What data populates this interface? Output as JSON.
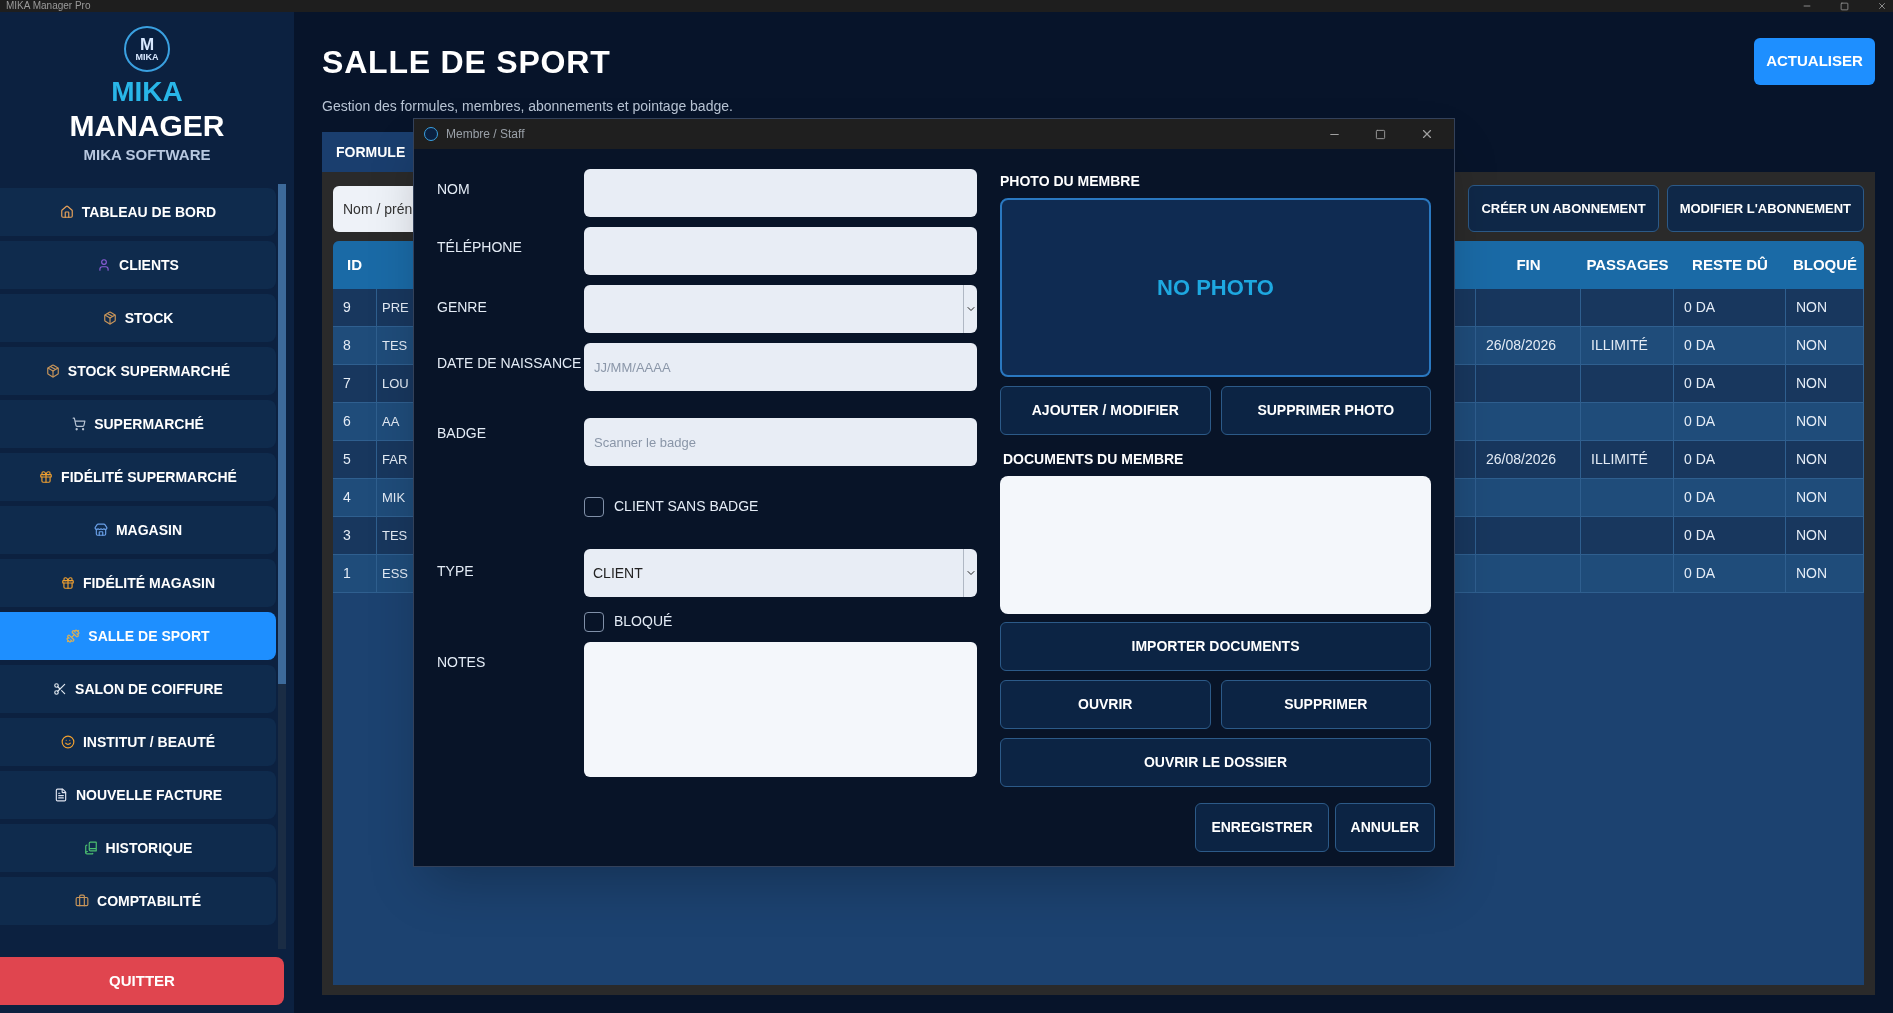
{
  "window": {
    "title": "MIKA Manager Pro"
  },
  "sidebar": {
    "logo": {
      "mark": "M",
      "text": "MIKA"
    },
    "brand_top": "MIKA",
    "brand_bottom": "MANAGER",
    "subtitle": "MIKA SOFTWARE",
    "items": [
      {
        "label": "TABLEAU DE BORD",
        "selected": false
      },
      {
        "label": "CLIENTS",
        "selected": false
      },
      {
        "label": "STOCK",
        "selected": false
      },
      {
        "label": "STOCK SUPERMARCHÉ",
        "selected": false
      },
      {
        "label": "SUPERMARCHÉ",
        "selected": false
      },
      {
        "label": "FIDÉLITÉ SUPERMARCHÉ",
        "selected": false
      },
      {
        "label": "MAGASIN",
        "selected": false
      },
      {
        "label": "FIDÉLITÉ MAGASIN",
        "selected": false
      },
      {
        "label": "SALLE DE SPORT",
        "selected": true
      },
      {
        "label": "SALON DE COIFFURE",
        "selected": false
      },
      {
        "label": "INSTITUT / BEAUTÉ",
        "selected": false
      },
      {
        "label": "NOUVELLE FACTURE",
        "selected": false
      },
      {
        "label": "HISTORIQUE",
        "selected": false
      },
      {
        "label": "COMPTABILITÉ",
        "selected": false
      }
    ],
    "quit_button": "QUITTER"
  },
  "page": {
    "title": "SALLE DE SPORT",
    "subtitle": "Gestion des formules, membres, abonnements et pointage badge.",
    "refresh_button": "ACTUALISER"
  },
  "tabs": [
    {
      "label": "FORMULE",
      "selected": true
    }
  ],
  "search": {
    "placeholder": "Nom / prén"
  },
  "actions": [
    "CRÉER UN ABONNEMENT",
    "MODIFIER L'ABONNEMENT"
  ],
  "table": {
    "columns": {
      "id": "ID",
      "fin": "FIN",
      "passages": "PASSAGES",
      "reste_du": "RESTE DÛ",
      "bloque": "BLOQUÉ"
    },
    "rows": [
      {
        "id": "9",
        "column_2": "PRE",
        "reste_du": "0 DA",
        "bloque": "NON"
      },
      {
        "id": "8",
        "column_2": "TES",
        "fin": "26/08/2026",
        "passages": "ILLIMITÉ",
        "reste_du": "0 DA",
        "bloque": "NON"
      },
      {
        "id": "7",
        "column_2": "LOU",
        "reste_du": "0 DA",
        "bloque": "NON"
      },
      {
        "id": "6",
        "column_2": "AA",
        "reste_du": "0 DA",
        "bloque": "NON"
      },
      {
        "id": "5",
        "column_2": "FAR",
        "fin": "26/08/2026",
        "passages": "ILLIMITÉ",
        "reste_du": "0 DA",
        "bloque": "NON"
      },
      {
        "id": "4",
        "column_2": "MIK",
        "reste_du": "0 DA",
        "bloque": "NON"
      },
      {
        "id": "3",
        "column_2": "TES",
        "reste_du": "0 DA",
        "bloque": "NON"
      },
      {
        "id": "1",
        "column_2": "ESS",
        "reste_du": "0 DA",
        "bloque": "NON"
      }
    ]
  },
  "dialog": {
    "title": "Membre / Staff",
    "fields": [
      {
        "kind": "text",
        "label": "NOM"
      },
      {
        "kind": "text",
        "label": "TÉLÉPHONE"
      },
      {
        "kind": "select",
        "label": "GENRE"
      },
      {
        "kind": "text",
        "label": "DATE DE NAISSANCE",
        "placeholder": "JJ/MM/AAAA"
      },
      {
        "kind": "text",
        "label": "BADGE",
        "placeholder": "Scanner le badge"
      },
      {
        "kind": "checkbox",
        "label": "CLIENT SANS BADGE",
        "checked": false
      },
      {
        "kind": "select",
        "label": "TYPE",
        "value": "CLIENT"
      },
      {
        "kind": "checkbox",
        "label": "BLOQUÉ",
        "checked": false
      },
      {
        "kind": "textarea",
        "label": "NOTES"
      }
    ],
    "photo": {
      "heading": "PHOTO DU MEMBRE",
      "empty_text": "NO PHOTO",
      "buttons": [
        "AJOUTER / MODIFIER",
        "SUPPRIMER PHOTO"
      ]
    },
    "documents": {
      "heading": "DOCUMENTS DU MEMBRE",
      "buttons": [
        "IMPORTER DOCUMENTS",
        "OUVRIR",
        "SUPPRIMER",
        "OUVRIR LE DOSSIER"
      ]
    },
    "footer_buttons": [
      "ENREGISTRER",
      "ANNULER"
    ]
  }
}
